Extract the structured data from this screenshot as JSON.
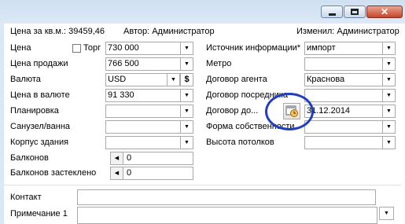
{
  "header": {
    "price_per_sqm": "Цена за кв.м.: 39459,46",
    "author": "Автор: Администратор",
    "modified": "Изменил: Администратор"
  },
  "left": {
    "price_label": "Цена",
    "torg_label": "Торг",
    "price_value": "730 000",
    "sale_price_label": "Цена продажи",
    "sale_price_value": "766 500",
    "currency_label": "Валюта",
    "currency_value": "USD",
    "currency_button": "$",
    "price_in_currency_label": "Цена в валюте",
    "price_in_currency_value": "91 330",
    "layout_label": "Планировка",
    "bathroom_label": "Санузел/ванна",
    "building_label": "Корпус здания",
    "balconies_label": "Балконов",
    "balconies_value": "0",
    "glazed_balconies_label": "Балконов застеклено",
    "glazed_balconies_value": "0"
  },
  "right": {
    "source_label": "Источник информации*",
    "source_value": "импорт",
    "metro_label": "Метро",
    "agent_contract_label": "Договор агента",
    "agent_contract_value": "Краснова",
    "mediator_contract_label": "Договор посредника",
    "contract_until_label": "Договор до...",
    "contract_until_value": "31.12.2014",
    "ownership_label": "Форма собственности",
    "ceiling_height_label": "Высота потолков"
  },
  "bottom": {
    "contact_label": "Контакт",
    "note_label": "Примечание 1"
  },
  "icons": {
    "calendar": "calendar-clock-icon",
    "dropdown": "chevron-down-icon",
    "spin_left": "arrow-left-icon"
  },
  "colors": {
    "highlight_circle": "#1f3fbf"
  }
}
